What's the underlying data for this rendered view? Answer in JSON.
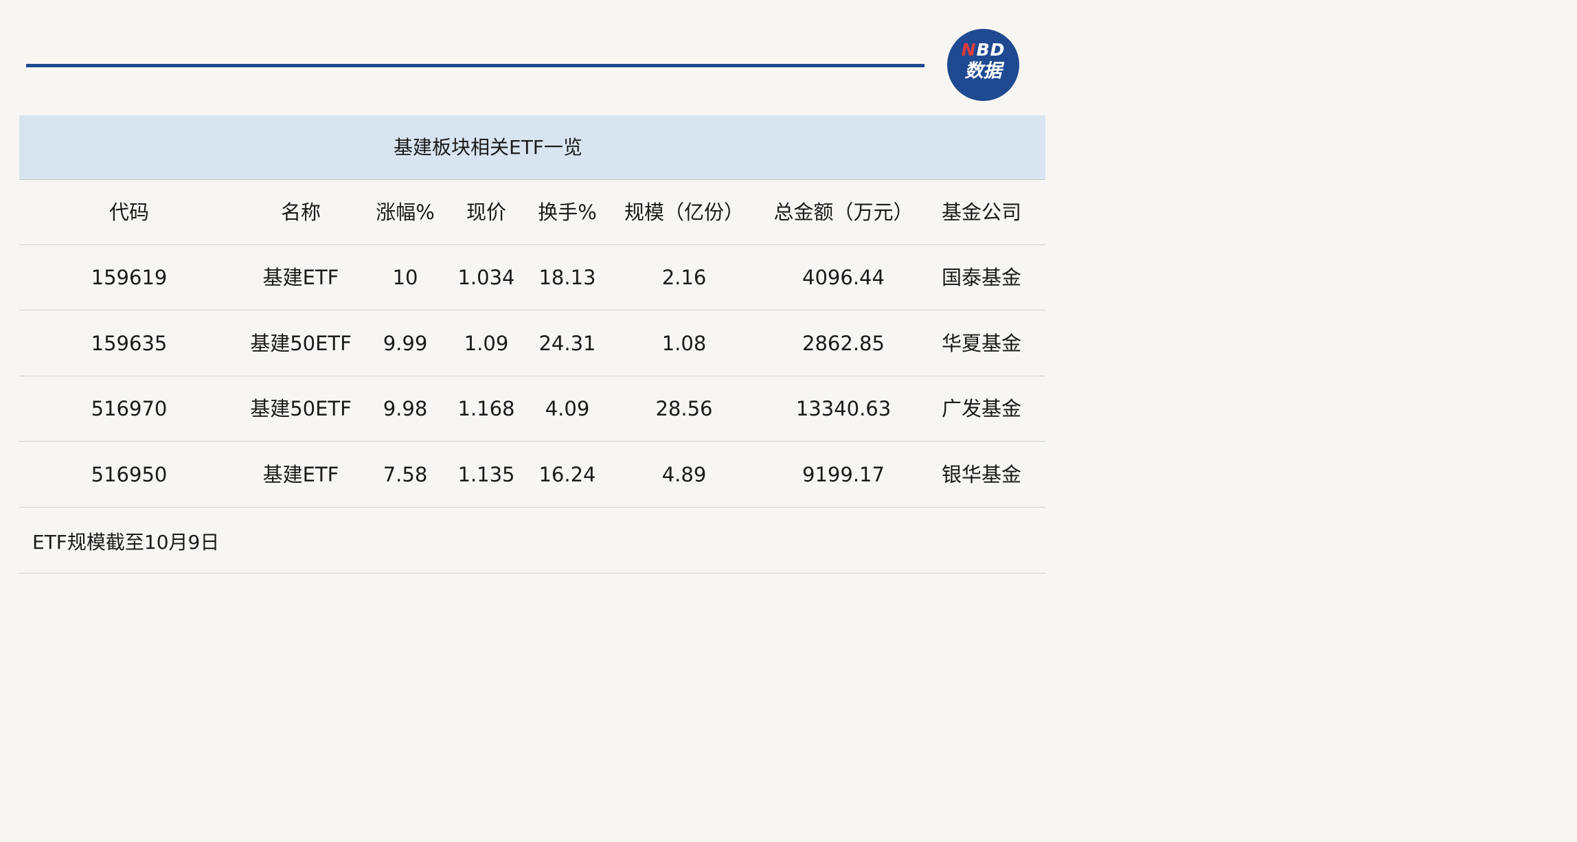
{
  "logo": {
    "letter_n": "N",
    "letters_bd": "BD",
    "subtitle": "数据"
  },
  "chart_data": {
    "type": "table",
    "title": "基建板块相关ETF一览",
    "columns": [
      "代码",
      "名称",
      "涨幅%",
      "现价",
      "换手%",
      "规模（亿份）",
      "总金额（万元）",
      "基金公司"
    ],
    "rows": [
      [
        "159619",
        "基建ETF",
        "10",
        "1.034",
        "18.13",
        "2.16",
        "4096.44",
        "国泰基金"
      ],
      [
        "159635",
        "基建50ETF",
        "9.99",
        "1.09",
        "24.31",
        "1.08",
        "2862.85",
        "华夏基金"
      ],
      [
        "516970",
        "基建50ETF",
        "9.98",
        "1.168",
        "4.09",
        "28.56",
        "13340.63",
        "广发基金"
      ],
      [
        "516950",
        "基建ETF",
        "7.58",
        "1.135",
        "16.24",
        "4.89",
        "9199.17",
        "银华基金"
      ]
    ],
    "note": "ETF规模截至10月9日"
  },
  "colors": {
    "accent": "#1f4a92",
    "title_band": "#d8e5f1",
    "background": "#f8f6f2",
    "logo_red": "#e23b3b"
  }
}
